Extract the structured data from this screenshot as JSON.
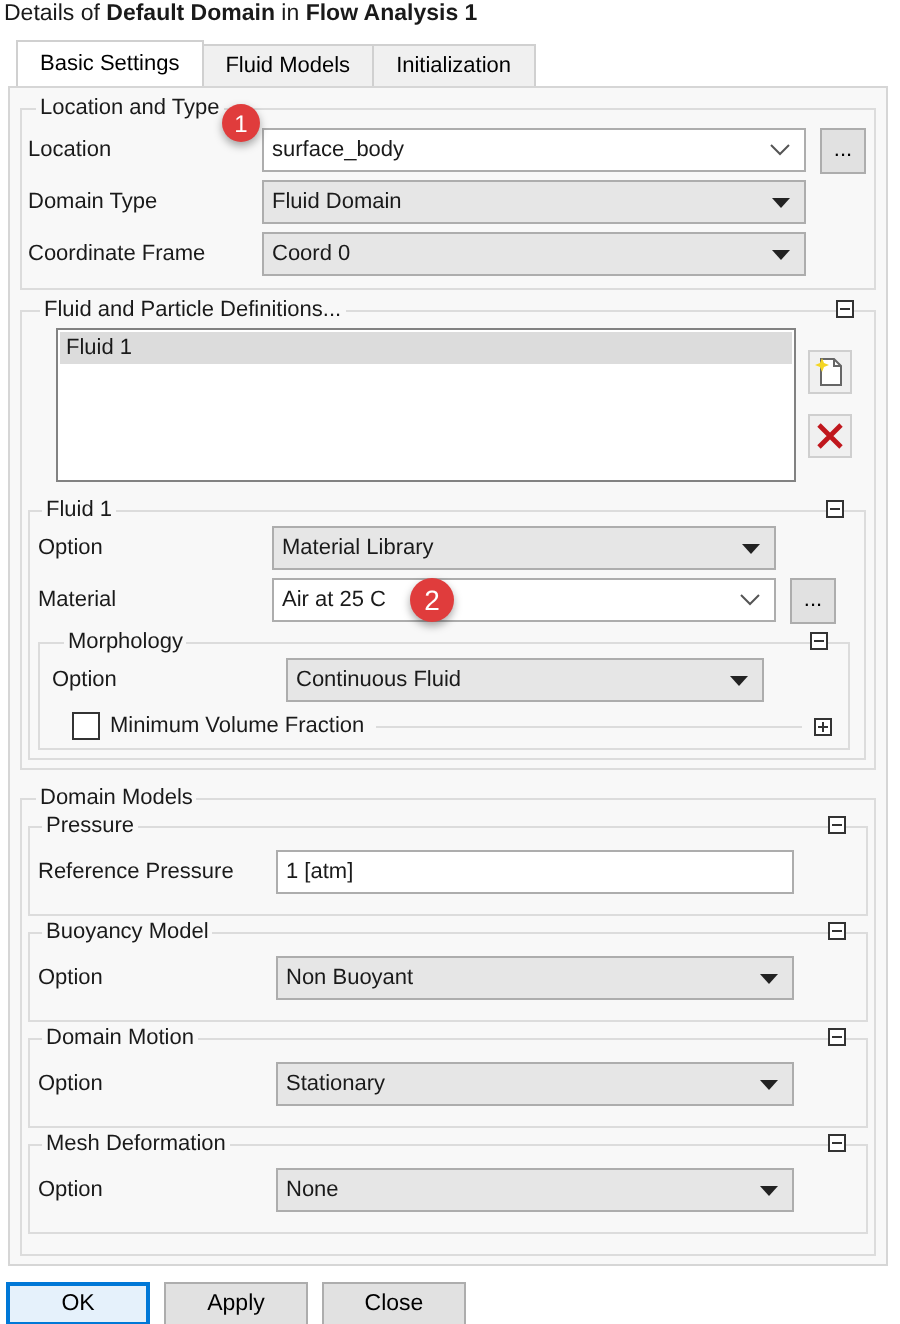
{
  "title": "Details of **Default Domain** in **Flow Analysis 1**",
  "tabs": [
    {
      "label": "Basic Settings",
      "selected": true
    },
    {
      "label": "Fluid Models",
      "selected": false
    },
    {
      "label": "Initialization",
      "selected": false
    }
  ],
  "location_group": {
    "title": "Location and Type",
    "marker": "1",
    "rows": [
      {
        "label": "Location",
        "kind": "combo",
        "value": "surface_body",
        "browse": "..."
      },
      {
        "label": "Domain Type",
        "kind": "dropdown",
        "value": "Fluid Domain"
      },
      {
        "label": "Coordinate Frame",
        "kind": "dropdown",
        "value": "Coord 0"
      }
    ]
  },
  "fluid_definitions": {
    "title": "Fluid and Particle Definitions...",
    "expanded": true,
    "list": [
      {
        "label": "Fluid 1",
        "selected": true
      }
    ],
    "fluid": {
      "title": "Fluid 1",
      "expanded": true,
      "rows": [
        {
          "label": "Option",
          "kind": "dropdown",
          "value": "Material Library"
        },
        {
          "label": "Material",
          "kind": "combo",
          "value": "Air at 25 C",
          "marker": "2",
          "browse": "..."
        }
      ],
      "morphology": {
        "title": "Morphology",
        "expanded": true,
        "rows": [
          {
            "label": "Option",
            "kind": "dropdown",
            "value": "Continuous Fluid"
          }
        ],
        "option_group": {
          "label": "Minimum Volume Fraction",
          "checked": false,
          "expanded": false
        }
      }
    }
  },
  "domain_models": {
    "title": "Domain Models",
    "sections": [
      {
        "title": "Pressure",
        "expanded": true,
        "rows": [
          {
            "label": "Reference Pressure",
            "kind": "text",
            "value": "1 [atm]"
          }
        ]
      },
      {
        "title": "Buoyancy Model",
        "expanded": true,
        "rows": [
          {
            "label": "Option",
            "kind": "dropdown",
            "value": "Non Buoyant"
          }
        ]
      },
      {
        "title": "Domain Motion",
        "expanded": true,
        "rows": [
          {
            "label": "Option",
            "kind": "dropdown",
            "value": "Stationary"
          }
        ]
      },
      {
        "title": "Mesh Deformation",
        "expanded": true,
        "rows": [
          {
            "label": "Option",
            "kind": "dropdown",
            "value": "None"
          }
        ]
      }
    ]
  },
  "buttons": [
    {
      "label": "OK",
      "focused": true
    },
    {
      "label": "Apply",
      "focused": false
    },
    {
      "label": "Close",
      "focused": false
    }
  ]
}
